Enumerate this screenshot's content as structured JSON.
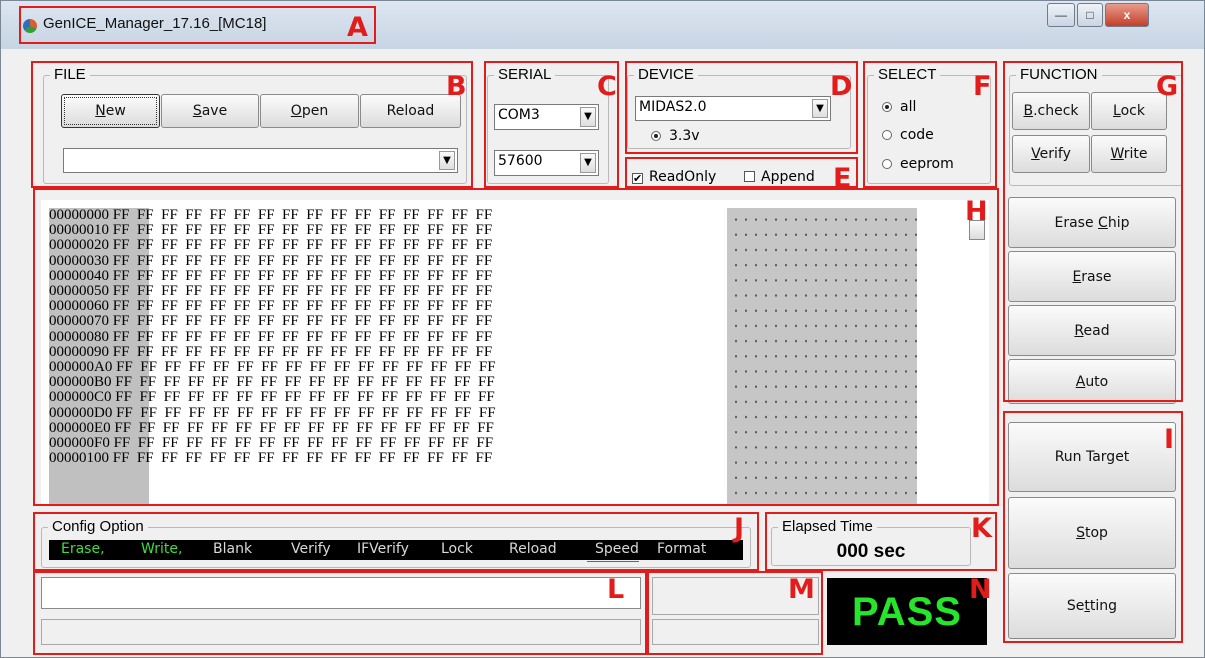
{
  "window": {
    "title": "GenICE_Manager_17.16_[MC18]",
    "minimize": "—",
    "maximize": "□",
    "close": "x"
  },
  "labels": [
    "A",
    "B",
    "C",
    "D",
    "E",
    "F",
    "G",
    "H",
    "I",
    "J",
    "K",
    "L",
    "M",
    "N"
  ],
  "file": {
    "legend": "FILE",
    "new_u": "N",
    "new_rest": "ew",
    "save_u": "S",
    "save_rest": "ave",
    "open_u": "O",
    "open_rest": "pen",
    "reload": "Reload",
    "path_value": ""
  },
  "serial": {
    "legend": "SERIAL",
    "port": "COM3",
    "baud": "57600"
  },
  "device": {
    "legend": "DEVICE",
    "selected": "MIDAS2.0",
    "voltage": "3.3v"
  },
  "options": {
    "readonly": "ReadOnly",
    "append": "Append"
  },
  "select": {
    "legend": "SELECT",
    "all": "all",
    "code": "code",
    "eeprom": "eeprom"
  },
  "function": {
    "legend": "FUNCTION",
    "bcheck_u": "B",
    "bcheck_rest": ".check",
    "lock_u": "L",
    "lock_rest": "ock",
    "verify_u": "V",
    "verify_rest": "erify",
    "write_u": "W",
    "write_rest": "rite"
  },
  "actions": {
    "erase_chip_pre": "Erase ",
    "erase_chip_u": "C",
    "erase_chip_rest": "hip",
    "erase_u": "E",
    "erase_rest": "rase",
    "read_u": "R",
    "read_rest": "ead",
    "auto_u": "A",
    "auto_rest": "uto",
    "run_target": "Run Target",
    "stop_u": "S",
    "stop_rest": "top",
    "setting_pre": "Se",
    "setting_u": "t",
    "setting_rest": "ting"
  },
  "hex": {
    "rows": [
      {
        "addr": "00000000",
        "bytes": "FF  FF  FF  FF  FF  FF  FF  FF  FF  FF  FF  FF  FF  FF  FF  FF"
      },
      {
        "addr": "00000010",
        "bytes": "FF  FF  FF  FF  FF  FF  FF  FF  FF  FF  FF  FF  FF  FF  FF  FF"
      },
      {
        "addr": "00000020",
        "bytes": "FF  FF  FF  FF  FF  FF  FF  FF  FF  FF  FF  FF  FF  FF  FF  FF"
      },
      {
        "addr": "00000030",
        "bytes": "FF  FF  FF  FF  FF  FF  FF  FF  FF  FF  FF  FF  FF  FF  FF  FF"
      },
      {
        "addr": "00000040",
        "bytes": "FF  FF  FF  FF  FF  FF  FF  FF  FF  FF  FF  FF  FF  FF  FF  FF"
      },
      {
        "addr": "00000050",
        "bytes": "FF  FF  FF  FF  FF  FF  FF  FF  FF  FF  FF  FF  FF  FF  FF  FF"
      },
      {
        "addr": "00000060",
        "bytes": "FF  FF  FF  FF  FF  FF  FF  FF  FF  FF  FF  FF  FF  FF  FF  FF"
      },
      {
        "addr": "00000070",
        "bytes": "FF  FF  FF  FF  FF  FF  FF  FF  FF  FF  FF  FF  FF  FF  FF  FF"
      },
      {
        "addr": "00000080",
        "bytes": "FF  FF  FF  FF  FF  FF  FF  FF  FF  FF  FF  FF  FF  FF  FF  FF"
      },
      {
        "addr": "00000090",
        "bytes": "FF  FF  FF  FF  FF  FF  FF  FF  FF  FF  FF  FF  FF  FF  FF  FF"
      },
      {
        "addr": "000000A0",
        "bytes": "FF  FF  FF  FF  FF  FF  FF  FF  FF  FF  FF  FF  FF  FF  FF  FF"
      },
      {
        "addr": "000000B0",
        "bytes": "FF  FF  FF  FF  FF  FF  FF  FF  FF  FF  FF  FF  FF  FF  FF  FF"
      },
      {
        "addr": "000000C0",
        "bytes": "FF  FF  FF  FF  FF  FF  FF  FF  FF  FF  FF  FF  FF  FF  FF  FF"
      },
      {
        "addr": "000000D0",
        "bytes": "FF  FF  FF  FF  FF  FF  FF  FF  FF  FF  FF  FF  FF  FF  FF  FF"
      },
      {
        "addr": "000000E0",
        "bytes": "FF  FF  FF  FF  FF  FF  FF  FF  FF  FF  FF  FF  FF  FF  FF  FF"
      },
      {
        "addr": "000000F0",
        "bytes": "FF  FF  FF  FF  FF  FF  FF  FF  FF  FF  FF  FF  FF  FF  FF  FF"
      },
      {
        "addr": "00000100",
        "bytes": "FF  FF  FF  FF  FF  FF  FF  FF  FF  FF  FF  FF  FF  FF  FF  FF"
      }
    ]
  },
  "config": {
    "legend": "Config Option",
    "items": [
      {
        "text": "Erase,",
        "on": true
      },
      {
        "text": "Write,",
        "on": true
      },
      {
        "text": "Blank",
        "on": false
      },
      {
        "text": "Verify",
        "on": false
      },
      {
        "text": "IFVerify",
        "on": false
      },
      {
        "text": "Lock",
        "on": false
      },
      {
        "text": "Reload",
        "on": false
      },
      {
        "text": "Speed",
        "on": false
      },
      {
        "text": "Format",
        "on": false
      }
    ]
  },
  "elapsed": {
    "legend": "Elapsed Time",
    "value": "000 sec"
  },
  "status": {
    "result": "PASS",
    "message": ""
  },
  "colors": {
    "annotation": "#e21b1b",
    "config_on": "#3fdc3f",
    "pass": "#27e52a"
  }
}
